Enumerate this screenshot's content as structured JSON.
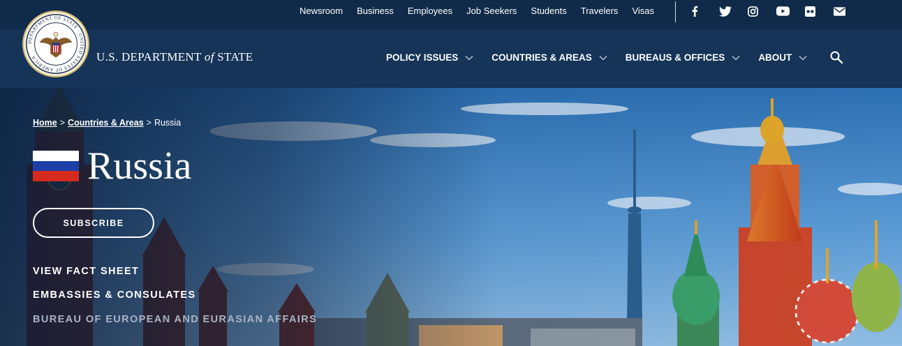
{
  "utility_nav": {
    "links": [
      "Newsroom",
      "Business",
      "Employees",
      "Job Seekers",
      "Students",
      "Travelers",
      "Visas"
    ],
    "social_icons": [
      "facebook-icon",
      "twitter-icon",
      "instagram-icon",
      "youtube-icon",
      "flickr-icon",
      "email-icon"
    ]
  },
  "header": {
    "seal_text": "DEPARTMENT OF STATE · UNITED STATES OF AMERICA",
    "brand_prefix": "U.S. DEPARTMENT ",
    "brand_of": "of",
    "brand_suffix": " STATE",
    "nav": [
      "POLICY ISSUES",
      "COUNTRIES & AREAS",
      "BUREAUS & OFFICES",
      "ABOUT"
    ]
  },
  "hero": {
    "breadcrumb": {
      "home": "Home",
      "countries": "Countries & Areas",
      "current": "Russia",
      "separator": ">"
    },
    "title": "Russia",
    "subscribe_label": "SUBSCRIBE",
    "links": [
      "VIEW FACT SHEET",
      "EMBASSIES & CONSULATES",
      "BUREAU OF EUROPEAN AND EURASIAN AFFAIRS"
    ]
  },
  "colors": {
    "utility_bg": "#102b49",
    "header_bg": "#153458",
    "flag_white": "#ffffff",
    "flag_blue": "#1c3fa8",
    "flag_red": "#d52b1e"
  }
}
